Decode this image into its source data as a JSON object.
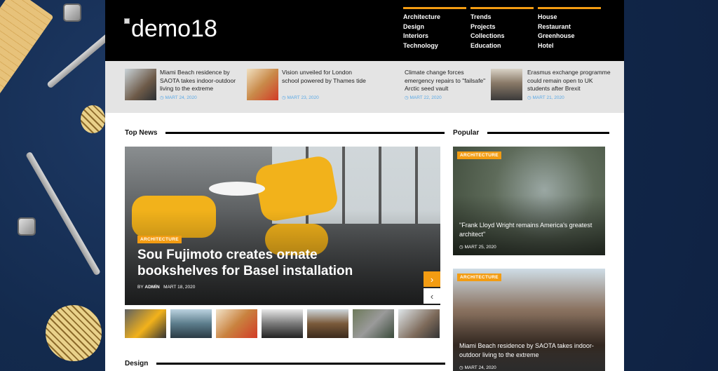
{
  "brand": {
    "logo_text": "demo18",
    "accent": "#f39c12"
  },
  "nav": {
    "columns": [
      [
        "Architecture",
        "Design",
        "Interiors",
        "Technology"
      ],
      [
        "Trends",
        "Projects",
        "Collections",
        "Education"
      ],
      [
        "House",
        "Restaurant",
        "Greenhouse",
        "Hotel"
      ]
    ]
  },
  "strip": [
    {
      "title": "Miami Beach residence by SAOTA takes indoor-outdoor living to the extreme",
      "date": "MART 24, 2020"
    },
    {
      "title": "Vision unveiled for London school powered by Thames tide",
      "date": "MART 23, 2020"
    },
    {
      "title": "Climate change forces emergency repairs to \"failsafe\" Arctic seed vault",
      "date": "MART 22, 2020"
    },
    {
      "title": "Erasmus exchange programme could remain open to UK students after Brexit",
      "date": "MART 21, 2020"
    }
  ],
  "sections": {
    "top_news": "Top News",
    "popular": "Popular",
    "design": "Design"
  },
  "hero": {
    "category": "ARCHITECTURE",
    "title": "Sou Fujimoto creates ornate bookshelves for Basel installation",
    "by": "BY",
    "author": "ADMİN",
    "date": "MART 18, 2020",
    "next_icon": "›",
    "prev_icon": "‹"
  },
  "popular": [
    {
      "category": "ARCHITECTURE",
      "title": "\"Frank Lloyd Wright remains America's greatest architect\"",
      "date": "MART 25, 2020"
    },
    {
      "category": "ARCHITECTURE",
      "title": "Miami Beach residence by SAOTA takes indoor-outdoor living to the extreme",
      "date": "MART 24, 2020"
    }
  ],
  "clock_icon": "◷"
}
